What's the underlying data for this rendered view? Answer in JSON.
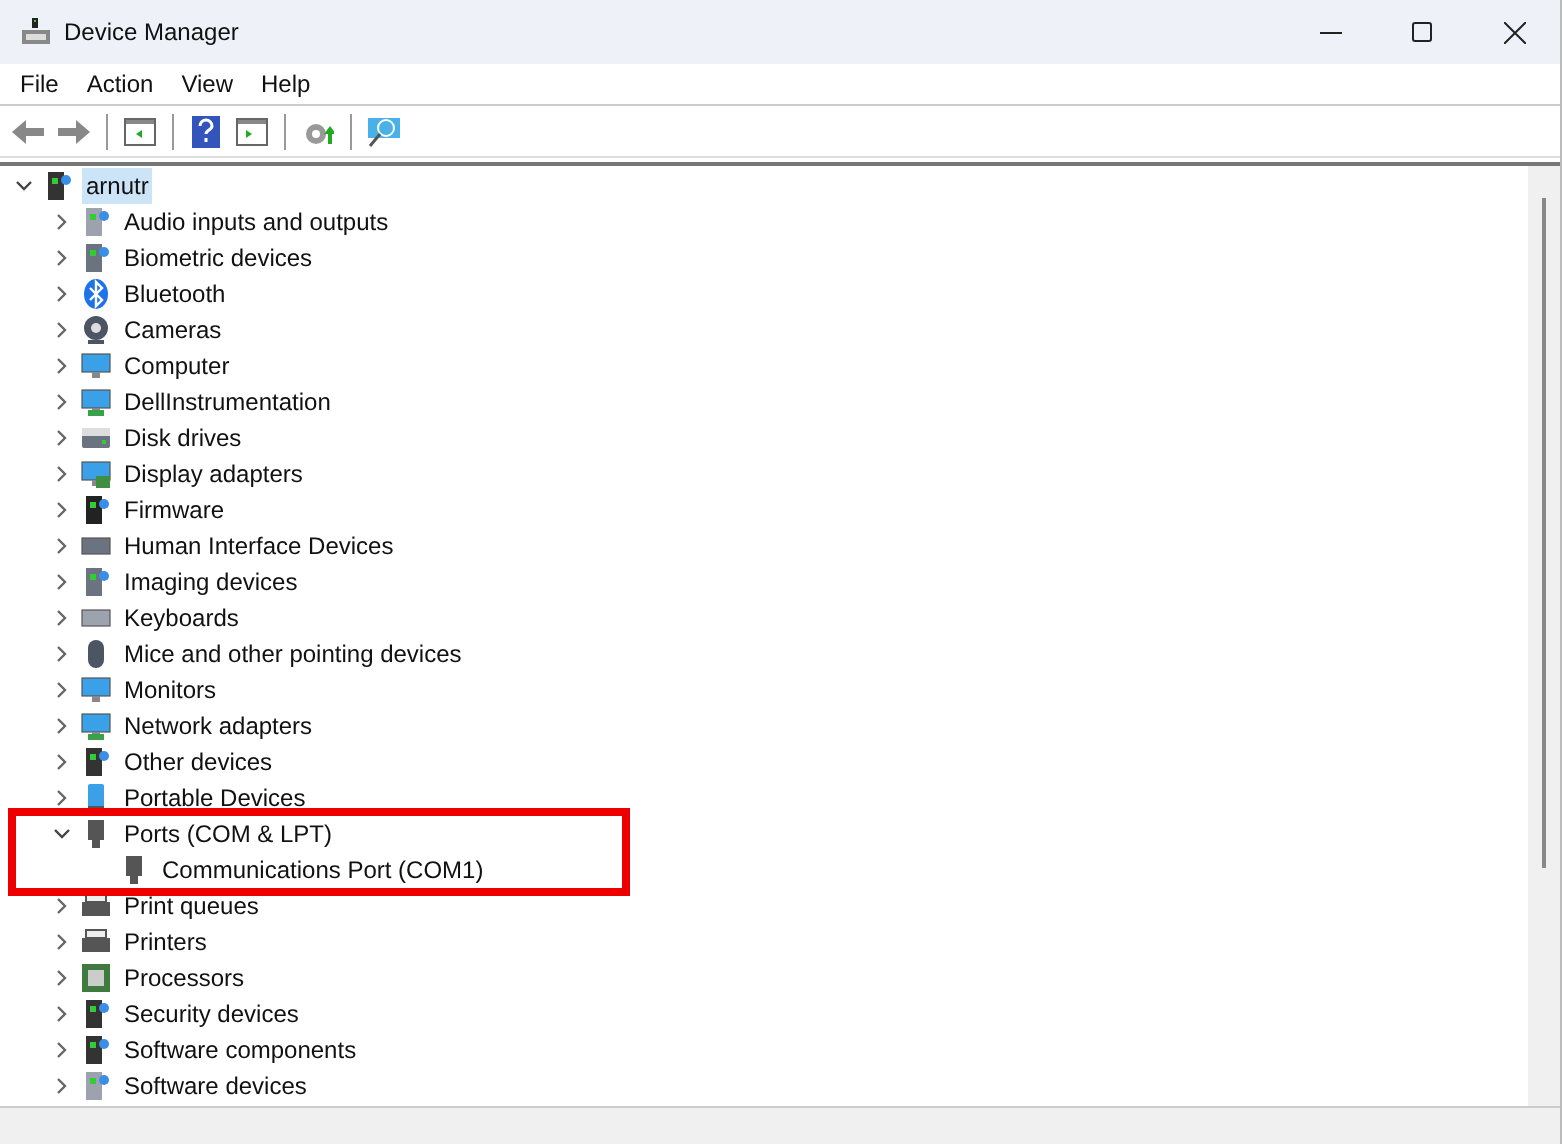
{
  "window": {
    "title": "Device Manager"
  },
  "menu": [
    "File",
    "Action",
    "View",
    "Help"
  ],
  "tree": [
    {
      "label": "arnutr",
      "expanded": true,
      "selected": true,
      "highlighted": false,
      "children": [
        {
          "label": "Audio inputs and outputs",
          "expanded": false,
          "selected": false,
          "highlighted": false
        },
        {
          "label": "Biometric devices",
          "expanded": false,
          "selected": false,
          "highlighted": false
        },
        {
          "label": "Bluetooth",
          "expanded": false,
          "selected": false,
          "highlighted": false
        },
        {
          "label": "Cameras",
          "expanded": false,
          "selected": false,
          "highlighted": false
        },
        {
          "label": "Computer",
          "expanded": false,
          "selected": false,
          "highlighted": false
        },
        {
          "label": "DellInstrumentation",
          "expanded": false,
          "selected": false,
          "highlighted": false
        },
        {
          "label": "Disk drives",
          "expanded": false,
          "selected": false,
          "highlighted": false
        },
        {
          "label": "Display adapters",
          "expanded": false,
          "selected": false,
          "highlighted": false
        },
        {
          "label": "Firmware",
          "expanded": false,
          "selected": false,
          "highlighted": false
        },
        {
          "label": "Human Interface Devices",
          "expanded": false,
          "selected": false,
          "highlighted": false
        },
        {
          "label": "Imaging devices",
          "expanded": false,
          "selected": false,
          "highlighted": false
        },
        {
          "label": "Keyboards",
          "expanded": false,
          "selected": false,
          "highlighted": false
        },
        {
          "label": "Mice and other pointing devices",
          "expanded": false,
          "selected": false,
          "highlighted": false
        },
        {
          "label": "Monitors",
          "expanded": false,
          "selected": false,
          "highlighted": false
        },
        {
          "label": "Network adapters",
          "expanded": false,
          "selected": false,
          "highlighted": false
        },
        {
          "label": "Other devices",
          "expanded": false,
          "selected": false,
          "highlighted": false
        },
        {
          "label": "Portable Devices",
          "expanded": false,
          "selected": false,
          "highlighted": false
        },
        {
          "label": "Ports (COM & LPT)",
          "expanded": true,
          "selected": false,
          "highlighted": true,
          "children": [
            {
              "label": "Communications Port (COM1)",
              "selected": false,
              "highlighted": false
            }
          ]
        },
        {
          "label": "Print queues",
          "expanded": false,
          "selected": false,
          "highlighted": false
        },
        {
          "label": "Printers",
          "expanded": false,
          "selected": false,
          "highlighted": false
        },
        {
          "label": "Processors",
          "expanded": false,
          "selected": false,
          "highlighted": false
        },
        {
          "label": "Security devices",
          "expanded": false,
          "selected": false,
          "highlighted": false
        },
        {
          "label": "Software components",
          "expanded": false,
          "selected": false,
          "highlighted": false
        },
        {
          "label": "Software devices",
          "expanded": false,
          "selected": false,
          "highlighted": false
        }
      ]
    }
  ]
}
